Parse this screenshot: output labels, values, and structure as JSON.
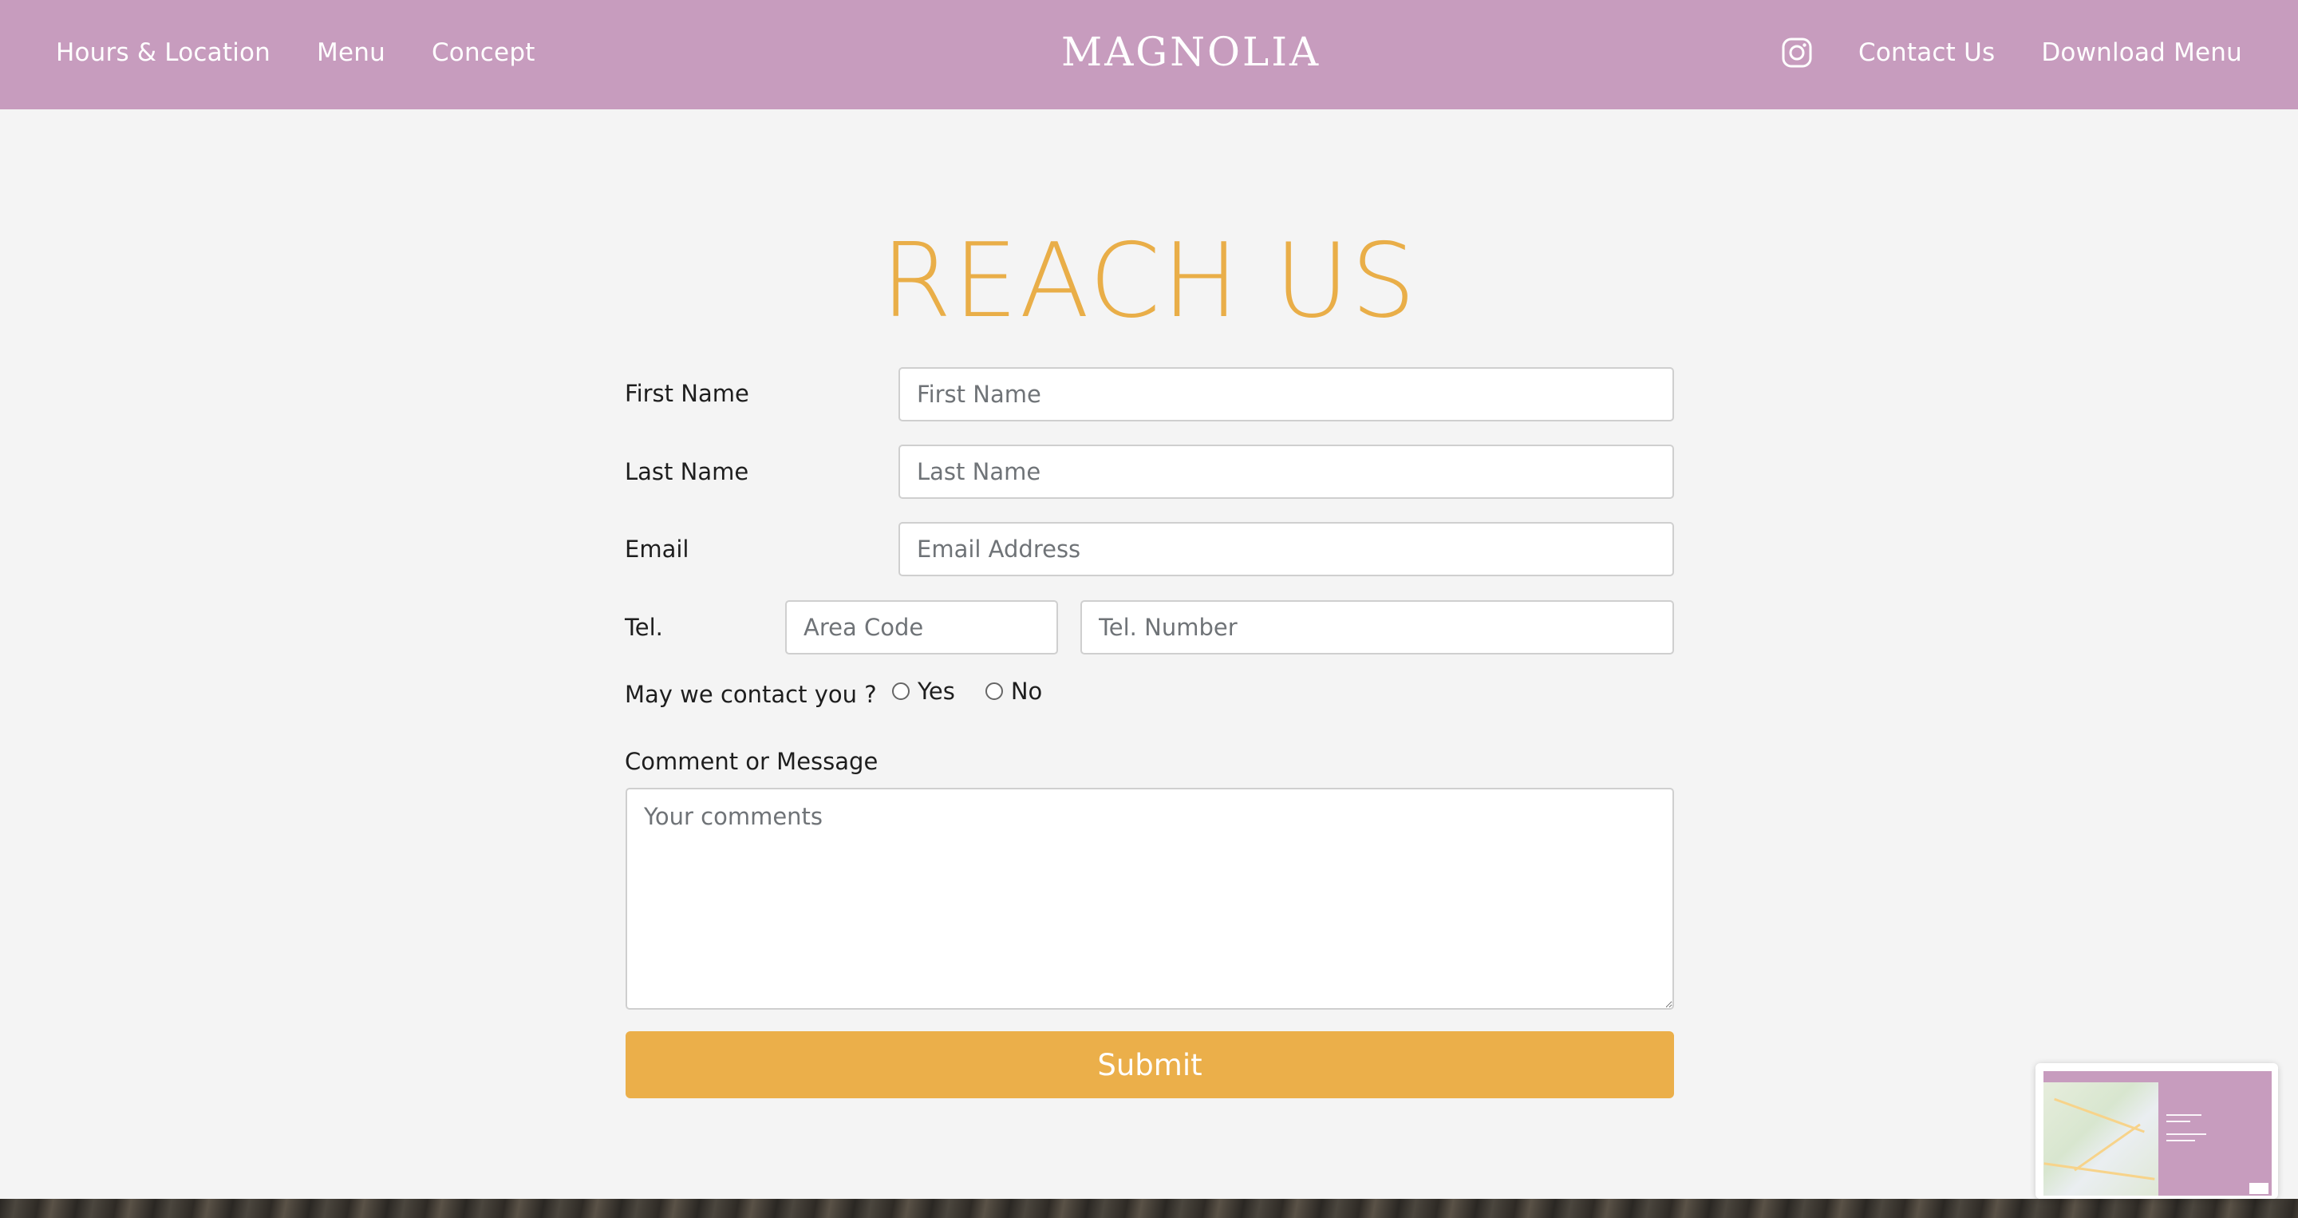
{
  "header": {
    "nav_left": [
      "Hours & Location",
      "Menu",
      "Concept"
    ],
    "logo": "MAGNOLIA",
    "instagram_icon": "instagram-icon",
    "nav_right": [
      "Contact Us",
      "Download Menu"
    ],
    "background_color": "#c79cbe"
  },
  "form": {
    "title": "REACH US",
    "first_name": {
      "label": "First Name",
      "placeholder": "First Name"
    },
    "last_name": {
      "label": "Last Name",
      "placeholder": "Last Name"
    },
    "email": {
      "label": "Email",
      "placeholder": "Email Address"
    },
    "tel": {
      "label": "Tel.",
      "area_placeholder": "Area Code",
      "number_placeholder": "Tel. Number"
    },
    "contact_permission": {
      "label": "May we contact you ?",
      "options": [
        "Yes",
        "No"
      ]
    },
    "comment": {
      "label": "Comment or Message",
      "placeholder": "Your comments"
    },
    "submit_label": "Submit",
    "accent_color": "#e9ae48"
  }
}
